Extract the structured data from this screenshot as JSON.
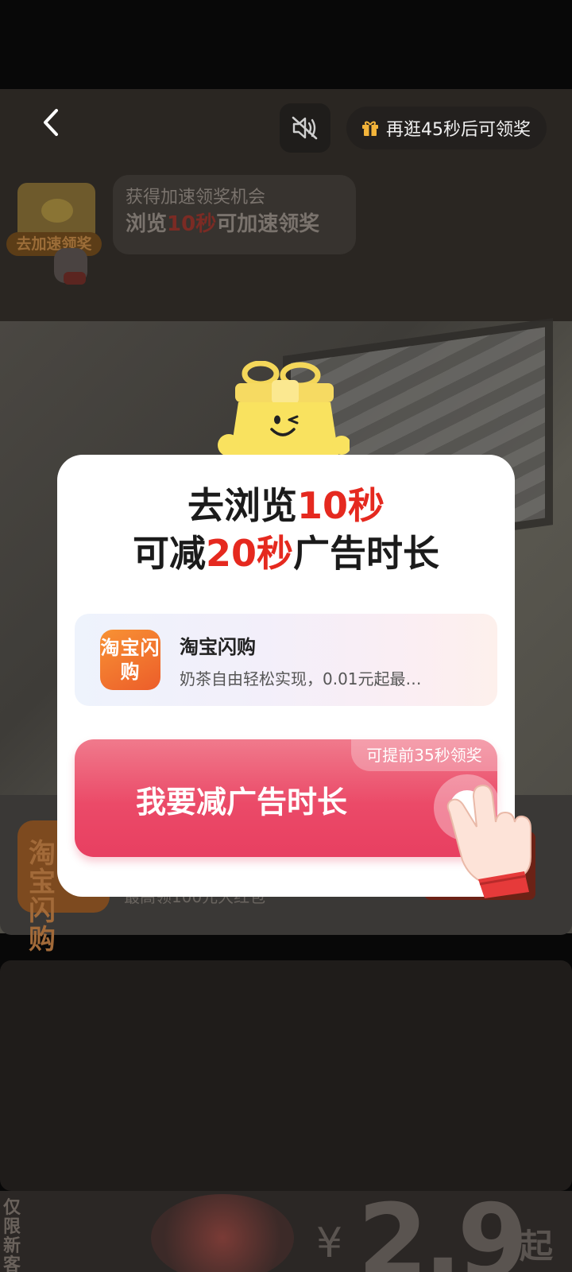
{
  "topbar": {
    "reward_text": "再逛45秒后可领奖"
  },
  "speedup": {
    "badge_label": "去加速领奖",
    "line1": "获得加速领奖机会",
    "line2_pre": "浏览",
    "line2_highlight": "10秒",
    "line2_post": "可加速领奖"
  },
  "modal": {
    "title_line1_pre": "去浏览",
    "title_line1_highlight": "10秒",
    "title_line2_pre": "可减",
    "title_line2_highlight": "20秒",
    "title_line2_post": "广告时长",
    "app": {
      "logo_text": "淘宝闪购",
      "name": "淘宝闪购",
      "description": "奶茶自由轻松实现，0.01元起最…"
    },
    "cta": {
      "label": "我要减广告时长",
      "badge": "可提前35秒领奖"
    }
  },
  "background": {
    "card_logo_text": "淘宝闪购",
    "card_subtitle": "最高领100元大红包",
    "promo_vertical": "仅限新客",
    "price_symbol": "¥",
    "price": "2.9",
    "price_suffix": "起"
  },
  "colors": {
    "accent_red": "#e5291f",
    "cta_pink": "#eb4a68",
    "logo_orange": "#f27a30"
  }
}
